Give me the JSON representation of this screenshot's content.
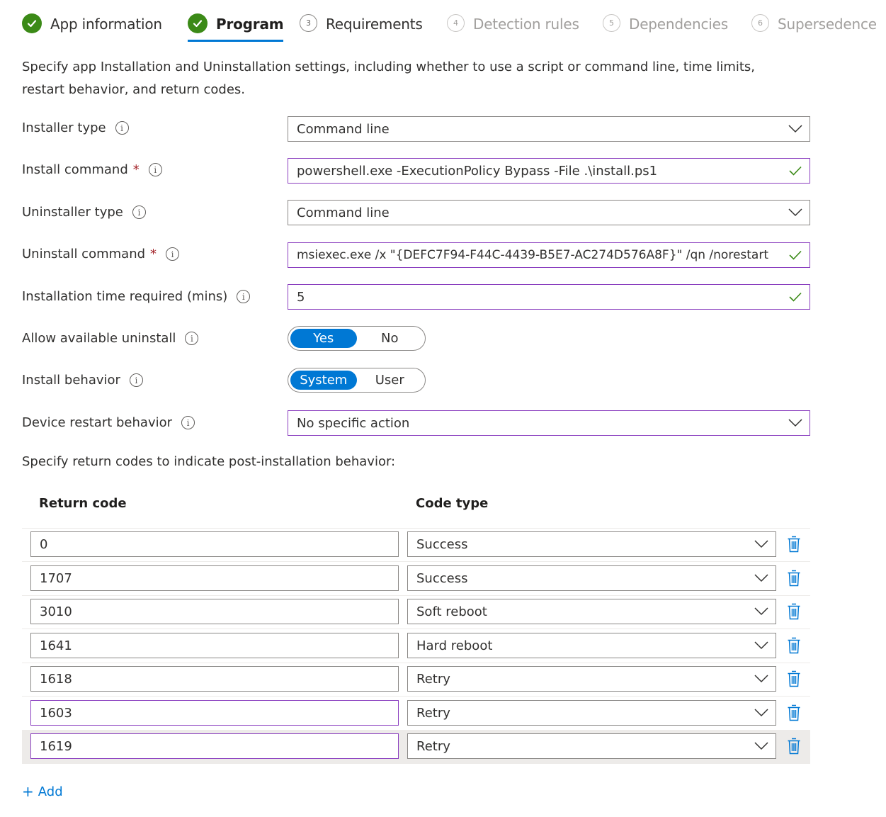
{
  "steps": [
    {
      "label": "App information",
      "state": "done",
      "number": ""
    },
    {
      "label": "Program",
      "state": "active",
      "number": ""
    },
    {
      "label": "Requirements",
      "state": "pending",
      "number": "3"
    },
    {
      "label": "Detection rules",
      "state": "future",
      "number": "4"
    },
    {
      "label": "Dependencies",
      "state": "future",
      "number": "5"
    },
    {
      "label": "Supersedence",
      "state": "future",
      "number": "6"
    }
  ],
  "intro": "Specify app Installation and Uninstallation settings, including whether to use a script or command line, time limits, restart behavior, and return codes.",
  "form": {
    "installer_type": {
      "label": "Installer type",
      "value": "Command line"
    },
    "install_command": {
      "label": "Install command",
      "required": "*",
      "value": "powershell.exe -ExecutionPolicy Bypass -File .\\install.ps1"
    },
    "uninstaller_type": {
      "label": "Uninstaller type",
      "value": "Command line"
    },
    "uninstall_command": {
      "label": "Uninstall command",
      "required": "*",
      "value": "msiexec.exe /x \"{DEFC7F94-F44C-4439-B5E7-AC274D576A8F}\" /qn /norestart"
    },
    "install_time": {
      "label": "Installation time required (mins)",
      "value": "5"
    },
    "allow_uninstall": {
      "label": "Allow available uninstall",
      "options": [
        "Yes",
        "No"
      ],
      "selected": "Yes"
    },
    "install_behavior": {
      "label": "Install behavior",
      "options": [
        "System",
        "User"
      ],
      "selected": "System"
    },
    "restart_behavior": {
      "label": "Device restart behavior",
      "value": "No specific action"
    }
  },
  "return_codes": {
    "subheading": "Specify return codes to indicate post-installation behavior:",
    "col_code": "Return code",
    "col_type": "Code type",
    "rows": [
      {
        "code": "0",
        "type": "Success"
      },
      {
        "code": "1707",
        "type": "Success"
      },
      {
        "code": "3010",
        "type": "Soft reboot"
      },
      {
        "code": "1641",
        "type": "Hard reboot"
      },
      {
        "code": "1618",
        "type": "Retry"
      },
      {
        "code": "1603",
        "type": "Retry"
      },
      {
        "code": "1619",
        "type": "Retry"
      }
    ],
    "add_label": "Add",
    "add_symbol": "+"
  },
  "colors": {
    "accent": "#0078d4",
    "success": "#3b8a17",
    "required": "#a4262c",
    "focus_border": "#8a3ebf"
  }
}
